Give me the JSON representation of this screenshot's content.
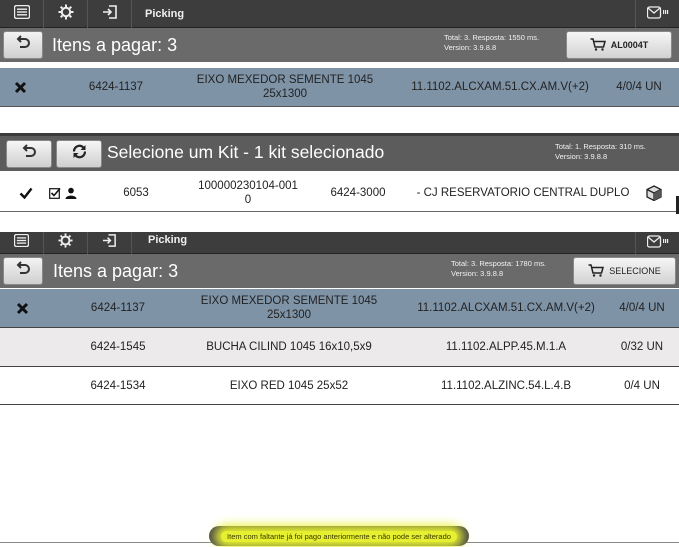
{
  "app": {
    "title": "Picking"
  },
  "screen1": {
    "header_title": "Itens a pagar: 3",
    "total_info": "Total: 3. Resposta: 1550 ms.",
    "version": "Version: 3.9.8.8",
    "action_label": "AL0004T",
    "rows": [
      {
        "code": "6424-1137",
        "desc": "EIXO MEXEDOR SEMENTE 1045 25x1300",
        "location": "11.1102.ALCXAM.51.CX.AM.V(+2)",
        "qty": "4/0/4 UN"
      }
    ]
  },
  "kit": {
    "title": "Selecione um Kit - 1 kit selecionado",
    "total_info": "Total: 1. Resposta: 310 ms.",
    "version": "Version: 3.9.8.8",
    "row": {
      "id": "6053",
      "order": "100000230104-001\n0",
      "code": "6424-3000",
      "desc": "- CJ RESERVATORIO CENTRAL DUPLO"
    }
  },
  "screen2": {
    "header_title": "Itens a pagar: 3",
    "total_info": "Total: 3. Resposta: 1780 ms.",
    "version": "Version: 3.9.8.8",
    "action_label": "SELECIONE",
    "rows": [
      {
        "code": "6424-1137",
        "desc": "EIXO MEXEDOR SEMENTE 1045 25x1300",
        "location": "11.1102.ALCXAM.51.CX.AM.V(+2)",
        "qty": "4/0/4 UN"
      },
      {
        "code": "6424-1545",
        "desc": "BUCHA CILIND 1045 16x10,5x9",
        "location": "11.1102.ALPP.45.M.1.A",
        "qty": "0/32 UN"
      },
      {
        "code": "6424-1534",
        "desc": "EIXO RED 1045 25x52",
        "location": "11.1102.ALZINC.54.L.4.B",
        "qty": "0/4 UN"
      }
    ]
  },
  "toast": {
    "message": "Item com faltante já foi pago anteriormente e não pode ser alterado"
  }
}
